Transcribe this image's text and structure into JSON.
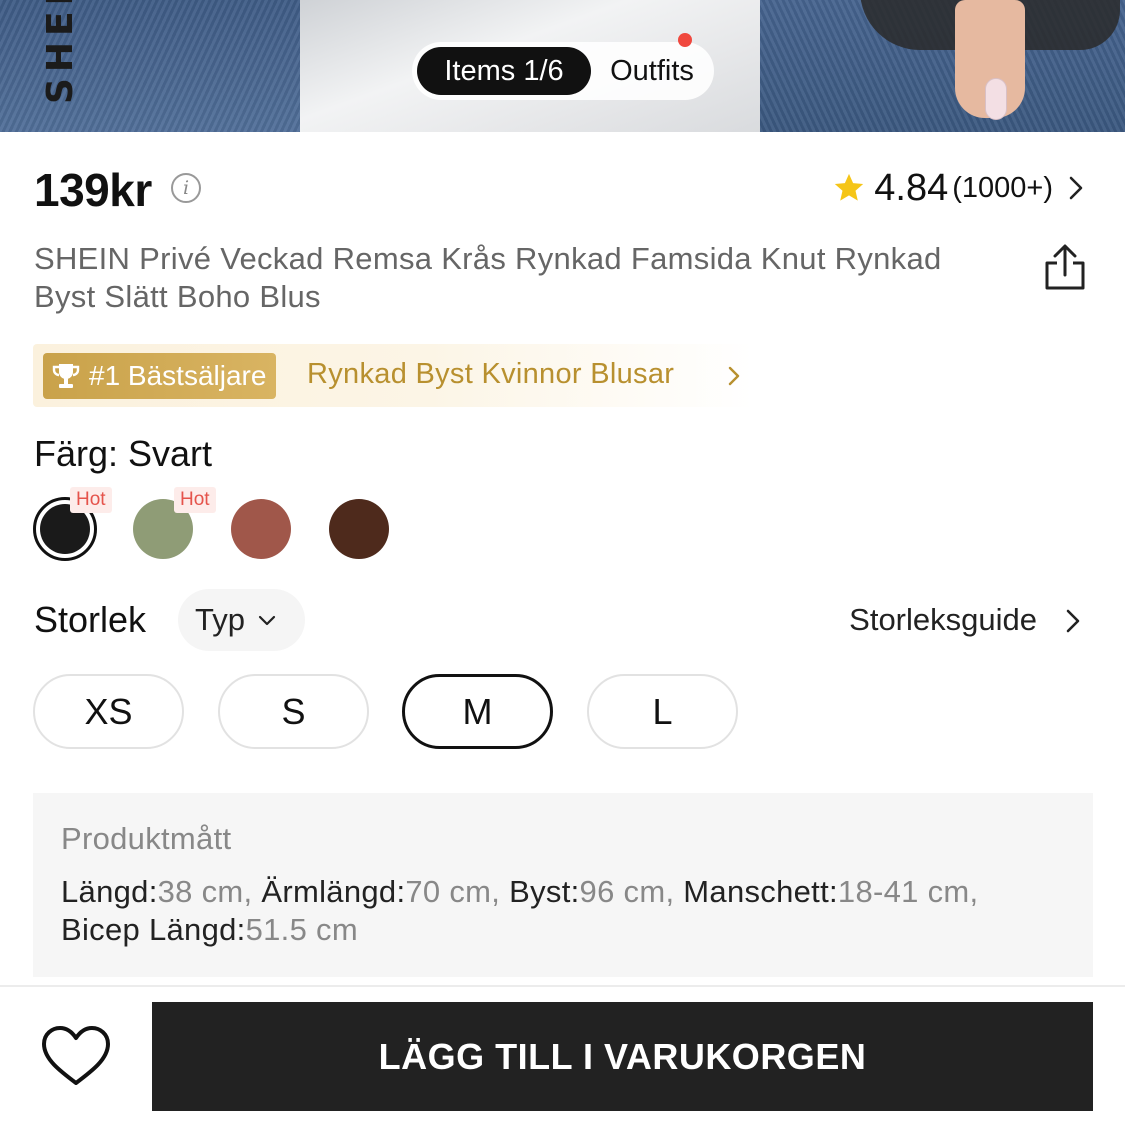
{
  "hero": {
    "brand_watermark": "SHEIN",
    "tabs": [
      {
        "label": "Items 1/6",
        "active": true
      },
      {
        "label": "Outfits",
        "active": false,
        "has_notification_dot": true
      }
    ]
  },
  "price": {
    "value": "139kr",
    "info_icon": "info-icon"
  },
  "rating": {
    "score": "4.84",
    "count": "(1000+)",
    "star_color": "#f5c518"
  },
  "product": {
    "title": "SHEIN Privé Veckad Remsa Krås Rynkad Famsida Knut Rynkad Byst Slätt Boho Blus",
    "share_icon": "share-icon"
  },
  "bestseller": {
    "badge": "#1 Bästsäljare",
    "category": "Rynkad Byst Kvinnor Blusar",
    "accent": "#c9a24a"
  },
  "color": {
    "label": "Färg: Svart",
    "swatches": [
      {
        "name": "Svart",
        "hex": "#1a1a1a",
        "selected": true,
        "tag": "Hot"
      },
      {
        "name": "Grön",
        "hex": "#8f9c76",
        "selected": false,
        "tag": "Hot"
      },
      {
        "name": "Rost",
        "hex": "#a0574a",
        "selected": false,
        "tag": ""
      },
      {
        "name": "Brun",
        "hex": "#4e2a1c",
        "selected": false,
        "tag": ""
      }
    ]
  },
  "size": {
    "label": "Storlek",
    "type_select": "Typ",
    "guide": "Storleksguide",
    "options": [
      {
        "label": "XS",
        "selected": false
      },
      {
        "label": "S",
        "selected": false
      },
      {
        "label": "M",
        "selected": true
      },
      {
        "label": "L",
        "selected": false
      }
    ]
  },
  "measurements": {
    "heading": "Produktmått",
    "items": [
      {
        "name": "Längd:",
        "value": "38 cm",
        "sep": ", "
      },
      {
        "name": "Ärmlängd:",
        "value": "70 cm",
        "sep": ", "
      },
      {
        "name": "Byst:",
        "value": "96 cm",
        "sep": ", "
      },
      {
        "name": "Manschett:",
        "value": "18-41 cm",
        "sep": ", "
      },
      {
        "name": "Bicep Längd:",
        "value": "51.5 cm",
        "sep": ""
      }
    ]
  },
  "bottom_bar": {
    "wishlist_icon": "heart-icon",
    "add_to_cart": "LÄGG TILL I VARUKORGEN"
  }
}
